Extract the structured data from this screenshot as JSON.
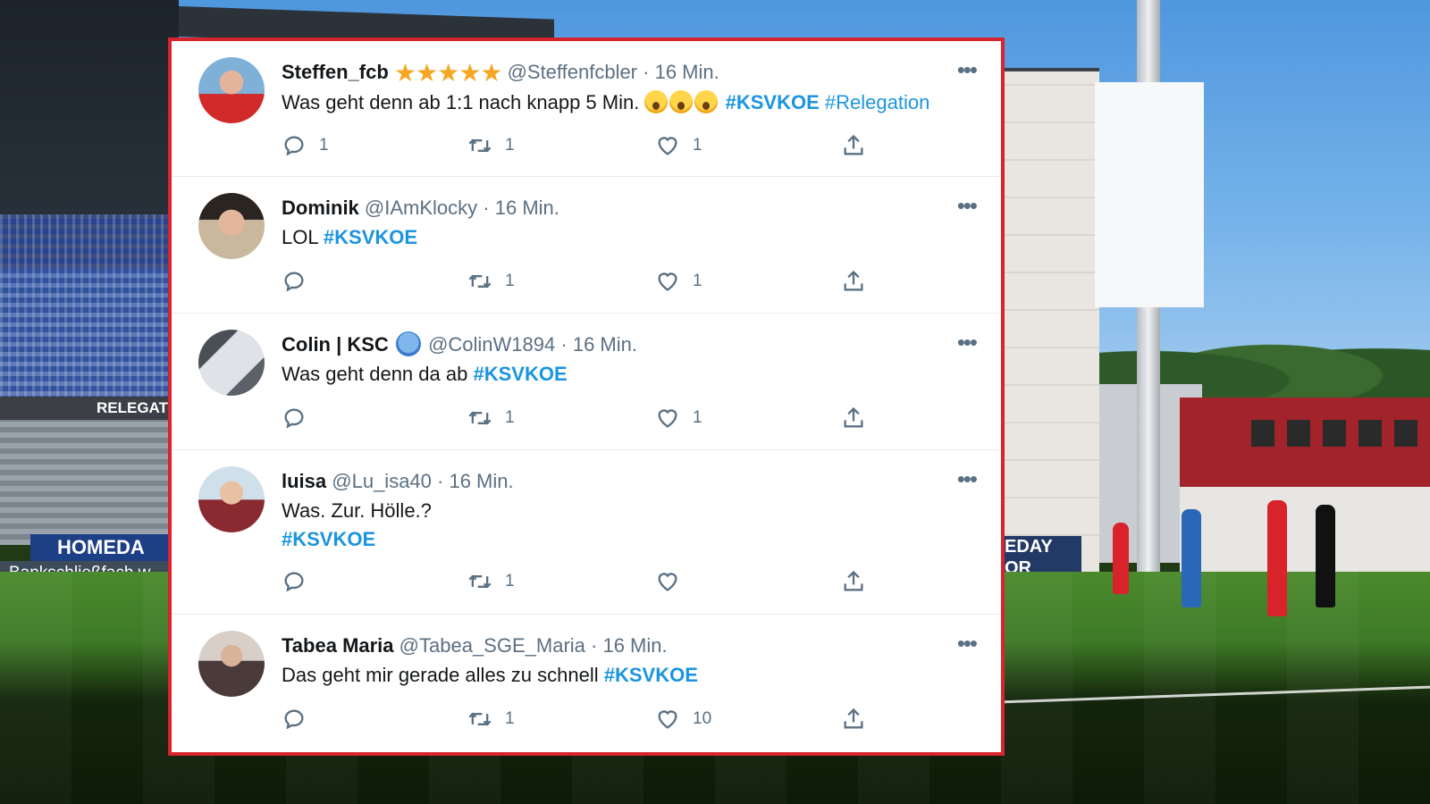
{
  "background": {
    "banner_left": "RELEGATI",
    "adboard_left": "HOMEDA",
    "adboard_left2": "Bankschließfach w",
    "adboard_right_top": "EDAY",
    "adboard_right_bottom": "OR"
  },
  "colors": {
    "card_border": "#d9232d",
    "hashtag": "#1b95e0",
    "muted": "#5b7083"
  },
  "tweets": [
    {
      "name": "Steffen_fcb",
      "decoration": "★★★★★",
      "handle": "@Steffenfcbler",
      "time": "· 16 Min.",
      "text": "Was geht denn ab 1:1 nach knapp 5 Min.",
      "hashtags": [
        "#KSVKOE",
        "#Relegation"
      ],
      "replies": "1",
      "retweets": "1",
      "likes": "1"
    },
    {
      "name": "Dominik",
      "handle": "@IAmKlocky",
      "time": "· 16 Min.",
      "text": "LOL",
      "hashtags": [
        "#KSVKOE"
      ],
      "replies": "",
      "retweets": "1",
      "likes": "1"
    },
    {
      "name": "Colin | KSC",
      "handle": "@ColinW1894",
      "time": "· 16 Min.",
      "text": "Was geht denn da ab",
      "hashtags": [
        "#KSVKOE"
      ],
      "replies": "",
      "retweets": "1",
      "likes": "1"
    },
    {
      "name": "luisa",
      "handle": "@Lu_isa40",
      "time": "· 16 Min.",
      "text": "Was. Zur. Hölle.?",
      "hashtags": [
        "#KSVKOE"
      ],
      "replies": "",
      "retweets": "1",
      "likes": ""
    },
    {
      "name": "Tabea Maria",
      "handle": "@Tabea_SGE_Maria",
      "time": "· 16 Min.",
      "text": "Das geht mir gerade alles zu schnell",
      "hashtags": [
        "#KSVKOE"
      ],
      "replies": "",
      "retweets": "1",
      "likes": "10"
    }
  ],
  "icons": {
    "reply": "reply-icon",
    "retweet": "retweet-icon",
    "like": "heart-icon",
    "share": "share-icon",
    "more": "more-icon"
  }
}
